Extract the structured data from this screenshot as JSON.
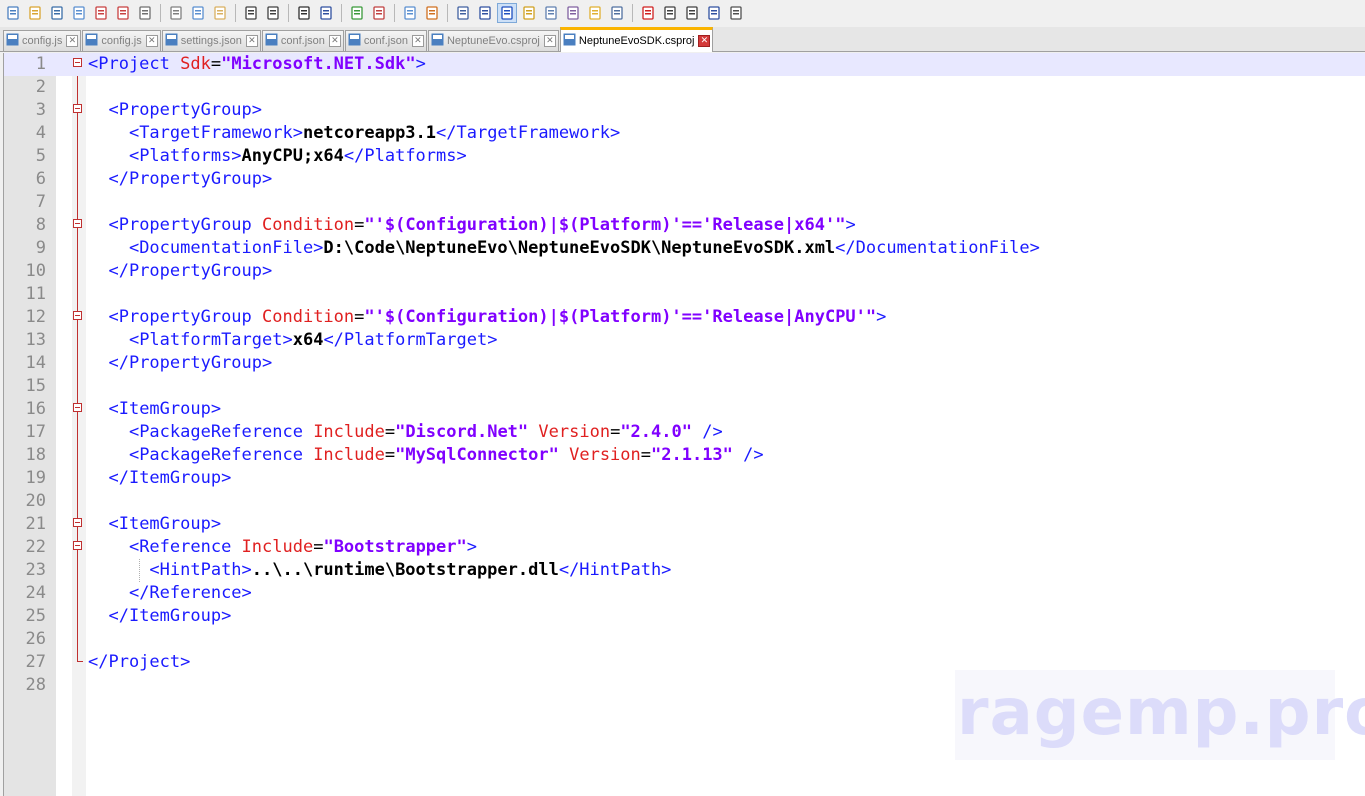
{
  "toolbar": {
    "buttons": [
      "new-file",
      "open-file",
      "save",
      "save-all",
      "close",
      "close-all",
      "print",
      "cut",
      "copy",
      "paste",
      "undo",
      "redo",
      "find",
      "replace",
      "zoom-in",
      "zoom-out",
      "sync-vertical",
      "sync-horizontal",
      "word-wrap",
      "show-all-chars",
      "indent-guide",
      "user-language",
      "doc-map",
      "function-list",
      "folder-as-workspace",
      "monitoring",
      "record-macro",
      "stop-record",
      "playback-macro",
      "run-macro-multiple",
      "save-macro"
    ]
  },
  "tabs": [
    {
      "label": "config.js",
      "active": false
    },
    {
      "label": "config.js",
      "active": false
    },
    {
      "label": "settings.json",
      "active": false
    },
    {
      "label": "conf.json",
      "active": false
    },
    {
      "label": "conf.json",
      "active": false
    },
    {
      "label": "NeptuneEvo.csproj",
      "active": false
    },
    {
      "label": "NeptuneEvoSDK.csproj",
      "active": true
    }
  ],
  "editor": {
    "current_line": 1,
    "lines": [
      {
        "n": "1",
        "tokens": [
          [
            "t",
            "<Project "
          ],
          [
            "a",
            "Sdk"
          ],
          [
            "p",
            "="
          ],
          [
            "v",
            "\"Microsoft.NET.Sdk\""
          ],
          [
            "t",
            ">"
          ]
        ]
      },
      {
        "n": "2",
        "tokens": []
      },
      {
        "n": "3",
        "tokens": [
          [
            "p",
            "  "
          ],
          [
            "t",
            "<PropertyGroup>"
          ]
        ]
      },
      {
        "n": "4",
        "tokens": [
          [
            "p",
            "    "
          ],
          [
            "t",
            "<TargetFramework>"
          ],
          [
            "x",
            "netcoreapp3.1"
          ],
          [
            "t",
            "</TargetFramework>"
          ]
        ]
      },
      {
        "n": "5",
        "tokens": [
          [
            "p",
            "    "
          ],
          [
            "t",
            "<Platforms>"
          ],
          [
            "x",
            "AnyCPU;x64"
          ],
          [
            "t",
            "</Platforms>"
          ]
        ]
      },
      {
        "n": "6",
        "tokens": [
          [
            "p",
            "  "
          ],
          [
            "t",
            "</PropertyGroup>"
          ]
        ]
      },
      {
        "n": "7",
        "tokens": []
      },
      {
        "n": "8",
        "tokens": [
          [
            "p",
            "  "
          ],
          [
            "t",
            "<PropertyGroup "
          ],
          [
            "a",
            "Condition"
          ],
          [
            "p",
            "="
          ],
          [
            "v",
            "\"'$(Configuration)|$(Platform)'=='Release|x64'\""
          ],
          [
            "t",
            ">"
          ]
        ]
      },
      {
        "n": "9",
        "tokens": [
          [
            "p",
            "    "
          ],
          [
            "t",
            "<DocumentationFile>"
          ],
          [
            "x",
            "D:\\Code\\NeptuneEvo\\NeptuneEvoSDK\\NeptuneEvoSDK.xml"
          ],
          [
            "t",
            "</DocumentationFile>"
          ]
        ]
      },
      {
        "n": "10",
        "tokens": [
          [
            "p",
            "  "
          ],
          [
            "t",
            "</PropertyGroup>"
          ]
        ]
      },
      {
        "n": "11",
        "tokens": []
      },
      {
        "n": "12",
        "tokens": [
          [
            "p",
            "  "
          ],
          [
            "t",
            "<PropertyGroup "
          ],
          [
            "a",
            "Condition"
          ],
          [
            "p",
            "="
          ],
          [
            "v",
            "\"'$(Configuration)|$(Platform)'=='Release|AnyCPU'\""
          ],
          [
            "t",
            ">"
          ]
        ]
      },
      {
        "n": "13",
        "tokens": [
          [
            "p",
            "    "
          ],
          [
            "t",
            "<PlatformTarget>"
          ],
          [
            "x",
            "x64"
          ],
          [
            "t",
            "</PlatformTarget>"
          ]
        ]
      },
      {
        "n": "14",
        "tokens": [
          [
            "p",
            "  "
          ],
          [
            "t",
            "</PropertyGroup>"
          ]
        ]
      },
      {
        "n": "15",
        "tokens": []
      },
      {
        "n": "16",
        "tokens": [
          [
            "p",
            "  "
          ],
          [
            "t",
            "<ItemGroup>"
          ]
        ]
      },
      {
        "n": "17",
        "tokens": [
          [
            "p",
            "    "
          ],
          [
            "t",
            "<PackageReference "
          ],
          [
            "a",
            "Include"
          ],
          [
            "p",
            "="
          ],
          [
            "v",
            "\"Discord.Net\""
          ],
          [
            "p",
            " "
          ],
          [
            "a",
            "Version"
          ],
          [
            "p",
            "="
          ],
          [
            "v",
            "\"2.4.0\""
          ],
          [
            "t",
            " />"
          ]
        ]
      },
      {
        "n": "18",
        "tokens": [
          [
            "p",
            "    "
          ],
          [
            "t",
            "<PackageReference "
          ],
          [
            "a",
            "Include"
          ],
          [
            "p",
            "="
          ],
          [
            "v",
            "\"MySqlConnector\""
          ],
          [
            "p",
            " "
          ],
          [
            "a",
            "Version"
          ],
          [
            "p",
            "="
          ],
          [
            "v",
            "\"2.1.13\""
          ],
          [
            "t",
            " />"
          ]
        ]
      },
      {
        "n": "19",
        "tokens": [
          [
            "p",
            "  "
          ],
          [
            "t",
            "</ItemGroup>"
          ]
        ]
      },
      {
        "n": "20",
        "tokens": []
      },
      {
        "n": "21",
        "tokens": [
          [
            "p",
            "  "
          ],
          [
            "t",
            "<ItemGroup>"
          ]
        ]
      },
      {
        "n": "22",
        "tokens": [
          [
            "p",
            "    "
          ],
          [
            "t",
            "<Reference "
          ],
          [
            "a",
            "Include"
          ],
          [
            "p",
            "="
          ],
          [
            "v",
            "\"Bootstrapper\""
          ],
          [
            "t",
            ">"
          ]
        ]
      },
      {
        "n": "23",
        "tokens": [
          [
            "p",
            "      "
          ],
          [
            "t",
            "<HintPath>"
          ],
          [
            "x",
            "..\\..\\runtime\\Bootstrapper.dll"
          ],
          [
            "t",
            "</HintPath>"
          ]
        ]
      },
      {
        "n": "24",
        "tokens": [
          [
            "p",
            "    "
          ],
          [
            "t",
            "</Reference>"
          ]
        ]
      },
      {
        "n": "25",
        "tokens": [
          [
            "p",
            "  "
          ],
          [
            "t",
            "</ItemGroup>"
          ]
        ]
      },
      {
        "n": "26",
        "tokens": []
      },
      {
        "n": "27",
        "tokens": [
          [
            "t",
            "</Project>"
          ]
        ]
      },
      {
        "n": "28",
        "tokens": []
      }
    ],
    "folds": {
      "open": [
        "1",
        "3",
        "8",
        "12",
        "16",
        "21",
        "22"
      ],
      "end": [
        "27"
      ]
    }
  },
  "watermark": {
    "text": "ragemp.pro"
  },
  "colors": {
    "tag": "#1a1aff",
    "attr": "#e02020",
    "value": "#8000ff",
    "text": "#000000",
    "current_line": "#e8e8ff"
  }
}
